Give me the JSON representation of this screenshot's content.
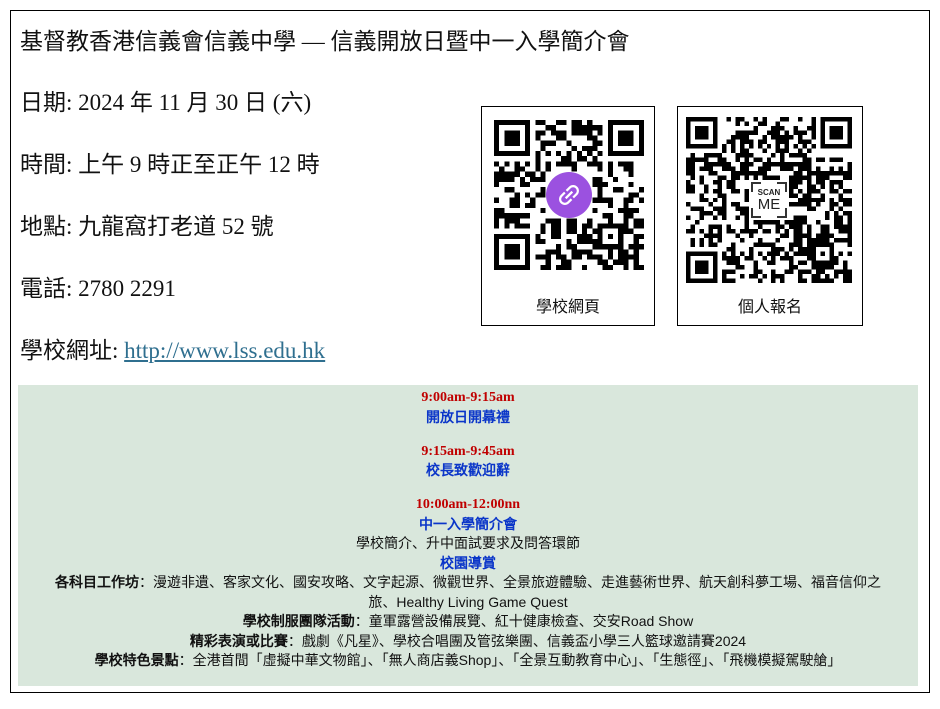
{
  "title": "基督教香港信義會信義中學 — 信義開放日暨中一入學簡介會",
  "info": [
    {
      "label": "日期:",
      "value": "2024 年 11 月 30 日 (六)"
    },
    {
      "label": "時間:",
      "value": "上午 9 時正至正午 12 時"
    },
    {
      "label": "地點:",
      "value": "九龍窩打老道 52 號"
    },
    {
      "label": "電話:",
      "value": "2780 2291"
    }
  ],
  "website": {
    "label": "學校網址:",
    "url": "http://www.lss.edu.hk"
  },
  "qr_codes": [
    {
      "caption": "學校網頁",
      "center_icon": "link-icon"
    },
    {
      "caption": "個人報名",
      "center_icon": "scan-me-icon",
      "center_text": {
        "top": "SCAN",
        "bottom": "ME"
      }
    }
  ],
  "schedule": [
    {
      "time": "9:00am-9:15am",
      "title": "開放日開幕禮"
    },
    {
      "time": "9:15am-9:45am",
      "title": "校長致歡迎辭"
    },
    {
      "time": "10:00am-12:00nn",
      "title": "中一入學簡介會",
      "description": "學校簡介、升中面試要求及問答環節",
      "subtitle": "校園導賞",
      "activities": [
        {
          "label": "各科目工作坊",
          "text": "：漫遊非遺、客家文化、國安攻略、文字起源、微觀世界、全景旅遊體驗、走進藝術世界、航天創科夢工場、福音信仰之旅、Healthy Living Game Quest"
        },
        {
          "label": "學校制服團隊活動",
          "text": "：童軍露營設備展覽、紅十健康檢查、交安Road Show"
        },
        {
          "label": "精彩表演或比賽",
          "text": "：戲劇《凡星》、學校合唱團及管弦樂團、信義盃小學三人籃球邀請賽2024"
        },
        {
          "label": "學校特色景點",
          "text": "：全港首間「虛擬中華文物館」、「無人商店義Shop」、「全景互動教育中心」、「生態徑」、「飛機模擬駕駛艙」"
        }
      ]
    }
  ],
  "colors": {
    "time_text": "#c00000",
    "heading_text": "#0b36c9",
    "link": "#2f6f8f",
    "panel_background": "#d9e7dc",
    "link_badge": "#9b51e0"
  }
}
